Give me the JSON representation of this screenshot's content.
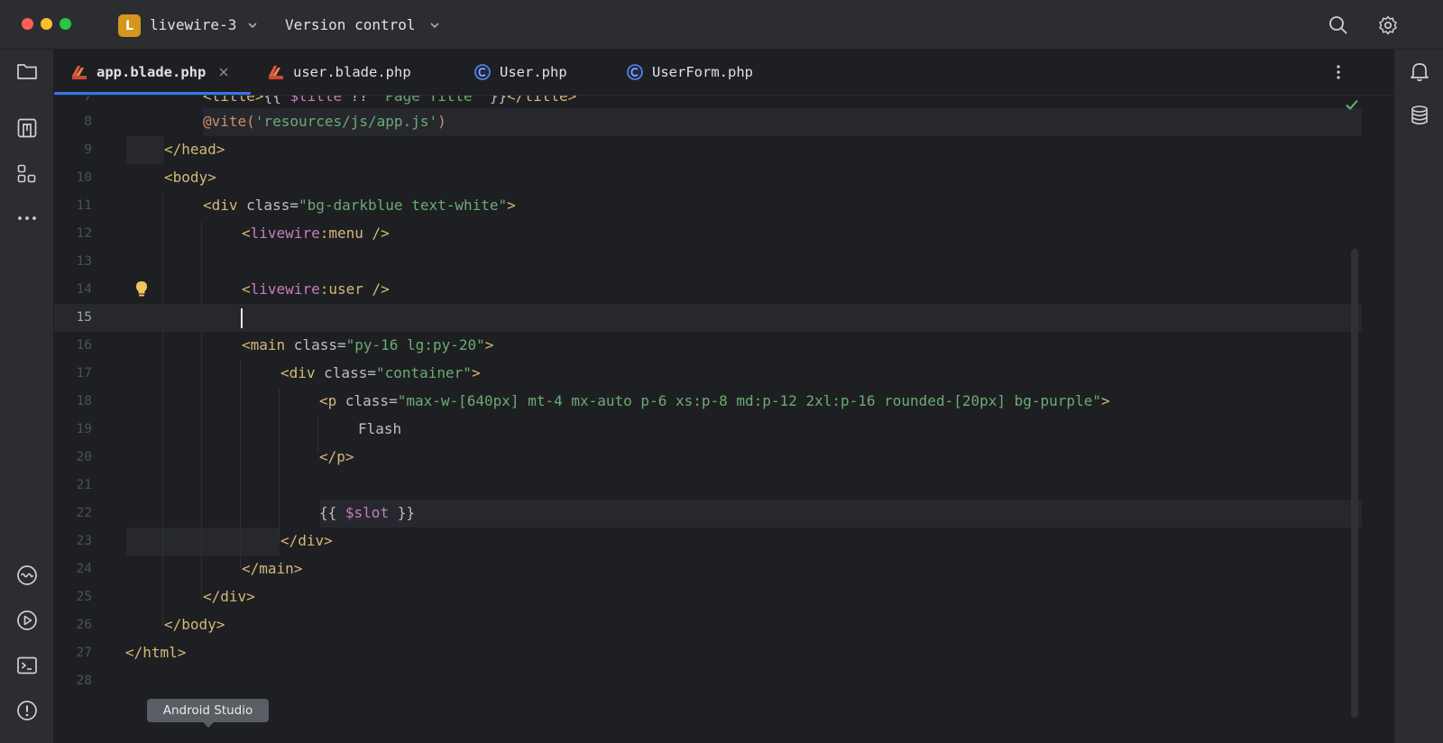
{
  "titlebar": {
    "project_badge": "L",
    "project_name": "livewire-3",
    "vcs_label": "Version control",
    "icons": [
      "search-icon",
      "gear-icon"
    ]
  },
  "left_toolbar": {
    "icons": [
      "folder-icon",
      "vcs-icon",
      "structure-icon",
      "more-icon",
      "services-icon",
      "run-icon",
      "terminal-icon",
      "problems-icon"
    ]
  },
  "right_toolbar": {
    "icons": [
      "notifications-icon",
      "database-icon"
    ]
  },
  "tabs": [
    {
      "label": "app.blade.php",
      "icon": "blade-icon",
      "active": true
    },
    {
      "label": "user.blade.php",
      "icon": "blade-icon",
      "active": false
    },
    {
      "label": "User.php",
      "icon": "class-icon",
      "active": false
    },
    {
      "label": "UserForm.php",
      "icon": "class-icon",
      "active": false
    }
  ],
  "editor": {
    "current_line": "15",
    "lines": [
      {
        "num": "7",
        "text": "<title>{{ $title ?? 'Page Title' }}</title>"
      },
      {
        "num": "8",
        "text": "@vite('resources/js/app.js')"
      },
      {
        "num": "9",
        "text": "</head>"
      },
      {
        "num": "10",
        "text": "<body>"
      },
      {
        "num": "11",
        "text": "<div class=\"bg-darkblue text-white\">"
      },
      {
        "num": "12",
        "text": "<livewire:menu />"
      },
      {
        "num": "13",
        "text": ""
      },
      {
        "num": "14",
        "text": "<livewire:user />"
      },
      {
        "num": "15",
        "text": ""
      },
      {
        "num": "16",
        "text": "<main class=\"py-16 lg:py-20\">"
      },
      {
        "num": "17",
        "text": "<div class=\"container\">"
      },
      {
        "num": "18",
        "text": "<p class=\"max-w-[640px] mt-4 mx-auto p-6 xs:p-8 md:p-12 2xl:p-16 rounded-[20px] bg-purple\">"
      },
      {
        "num": "19",
        "text": "Flash"
      },
      {
        "num": "20",
        "text": "</p>"
      },
      {
        "num": "21",
        "text": ""
      },
      {
        "num": "22",
        "text": "{{ $slot }}"
      },
      {
        "num": "23",
        "text": "</div>"
      },
      {
        "num": "24",
        "text": "</main>"
      },
      {
        "num": "25",
        "text": "</div>"
      },
      {
        "num": "26",
        "text": "</body>"
      },
      {
        "num": "27",
        "text": "</html>"
      },
      {
        "num": "28",
        "text": ""
      }
    ],
    "segments": {
      "l7a": "<title>",
      "l7b": "{{ ",
      "l7c": "$title",
      "l7d": " ?? ",
      "l7e": "'Page Title'",
      "l7f": " }}",
      "l7g": "</title>",
      "l8a": "@vite(",
      "l8b": "'resources/js/app.js'",
      "l8c": ")",
      "l9": "</head>",
      "l10": "<body>",
      "l11a": "<div",
      "l11b": " class=",
      "l11c": "\"bg-darkblue text-white\"",
      "l11d": ">",
      "l12a": "<",
      "l12b": "livewire",
      "l12c": ":menu />",
      "l14a": "<",
      "l14b": "livewire",
      "l14c": ":user />",
      "l16a": "<main",
      "l16b": " class=",
      "l16c": "\"py-16 lg:py-20\"",
      "l16d": ">",
      "l17a": "<div",
      "l17b": " class=",
      "l17c": "\"container\"",
      "l17d": ">",
      "l18a": "<p",
      "l18b": " class=",
      "l18c": "\"max-w-[640px] mt-4 mx-auto p-6 xs:p-8 md:p-12 2xl:p-16 rounded-[20px] bg-purple\"",
      "l18d": ">",
      "l19": "Flash",
      "l20": "</p>",
      "l22a": "{{ ",
      "l22b": "$slot",
      "l22c": " }}",
      "l23": "</div>",
      "l24": "</main>",
      "l25": "</div>",
      "l26": "</body>",
      "l27": "</html>"
    }
  },
  "tooltip": {
    "text": "Android Studio"
  },
  "colors": {
    "background": "#1e1f22",
    "panel": "#2b2d30",
    "accent": "#3574f0",
    "tag": "#d5b778",
    "string": "#6aab73",
    "livewire": "#c77dbb",
    "directive": "#cf8e6d",
    "project_badge": "#d6951c"
  }
}
